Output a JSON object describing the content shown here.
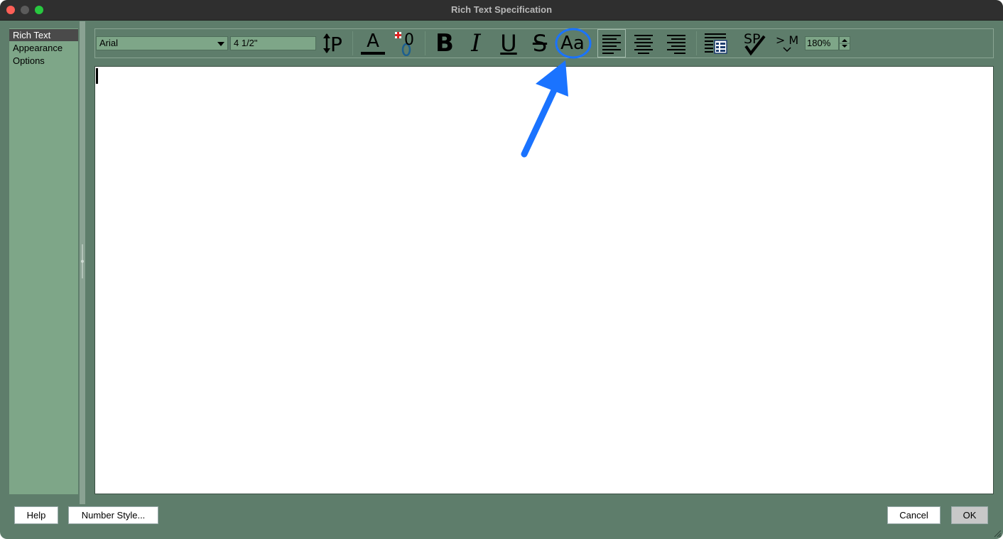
{
  "window": {
    "title": "Rich Text Specification"
  },
  "sidebar": {
    "items": [
      {
        "label": "Rich Text"
      },
      {
        "label": "Appearance"
      },
      {
        "label": "Options"
      }
    ]
  },
  "toolbar": {
    "font": "Arial",
    "size": "4 1/2\"",
    "line_spacing_glyph": "↕P",
    "text_color_glyph": "A",
    "super_glyph": "0",
    "bold_glyph": "B",
    "italic_glyph": "I",
    "underline_glyph": "U",
    "strike_glyph": "S",
    "case_glyph": "Aa",
    "spell_glyph": "SP",
    "macro_glyph": "> M",
    "zoom": "180%"
  },
  "buttons": {
    "help": "Help",
    "number_style": "Number Style...",
    "cancel": "Cancel",
    "ok": "OK"
  },
  "colors": {
    "window_bg": "#5e7d6b",
    "sidebar_bg": "#7ea688",
    "annotation_blue": "#1a73ff"
  }
}
